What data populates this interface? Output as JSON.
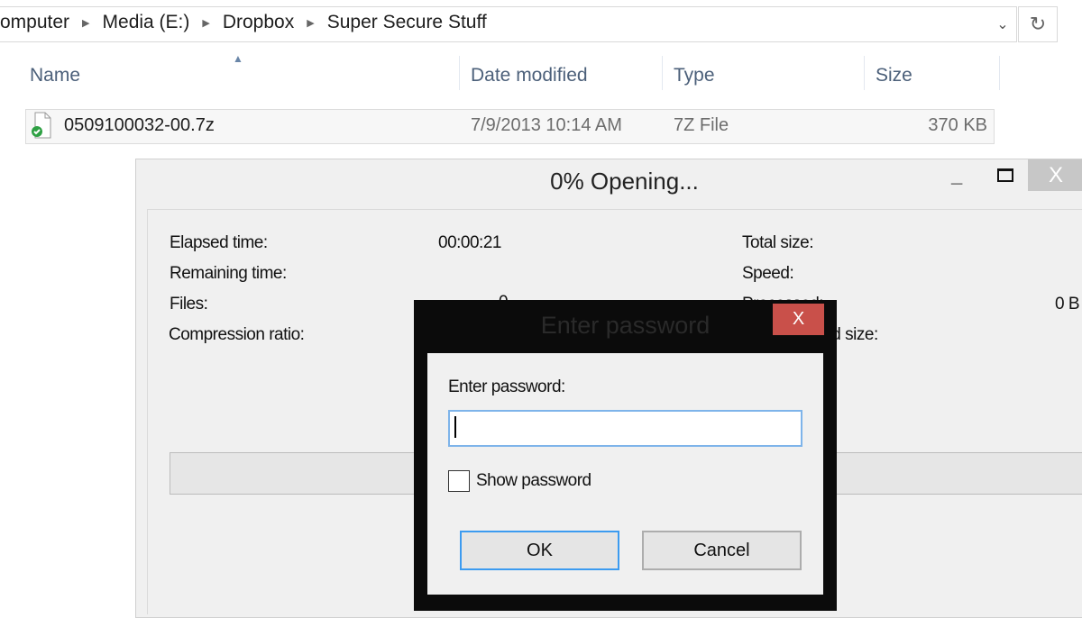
{
  "explorer": {
    "breadcrumb": [
      "omputer",
      "Media (E:)",
      "Dropbox",
      "Super Secure Stuff"
    ],
    "columns": {
      "name": "Name",
      "date": "Date modified",
      "type": "Type",
      "size": "Size"
    },
    "files": [
      {
        "name": "0509100032-00.7z",
        "date": "7/9/2013 10:14 AM",
        "type": "7Z File",
        "size": "370 KB",
        "icon": "7z-file-synced-icon"
      }
    ],
    "icons": {
      "dropdown": "chevron-down-icon",
      "refresh": "refresh-icon"
    }
  },
  "progress_window": {
    "title": "0% Opening...",
    "fields": {
      "elapsed_label": "Elapsed time:",
      "elapsed_value": "00:00:21",
      "remaining_label": "Remaining time:",
      "files_label": "Files:",
      "files_value": "0",
      "compression_label": "Compression ratio:",
      "total_size_label": "Total size:",
      "speed_label": "Speed:",
      "processed_label": "Processed:",
      "processed_value": "0 B",
      "packed_label": "Packed size:"
    },
    "progress_percent": 0,
    "close_label": "X"
  },
  "password_dialog": {
    "title": "Enter password",
    "close_label": "X",
    "prompt": "Enter password:",
    "password_value": "",
    "show_password_label": "Show password",
    "show_password_checked": false,
    "ok_label": "OK",
    "cancel_label": "Cancel"
  },
  "colors": {
    "accent_blue": "#3c9bf0",
    "dialog_close_red": "#c9504a",
    "dialog_frame": "#0b0b0b"
  }
}
